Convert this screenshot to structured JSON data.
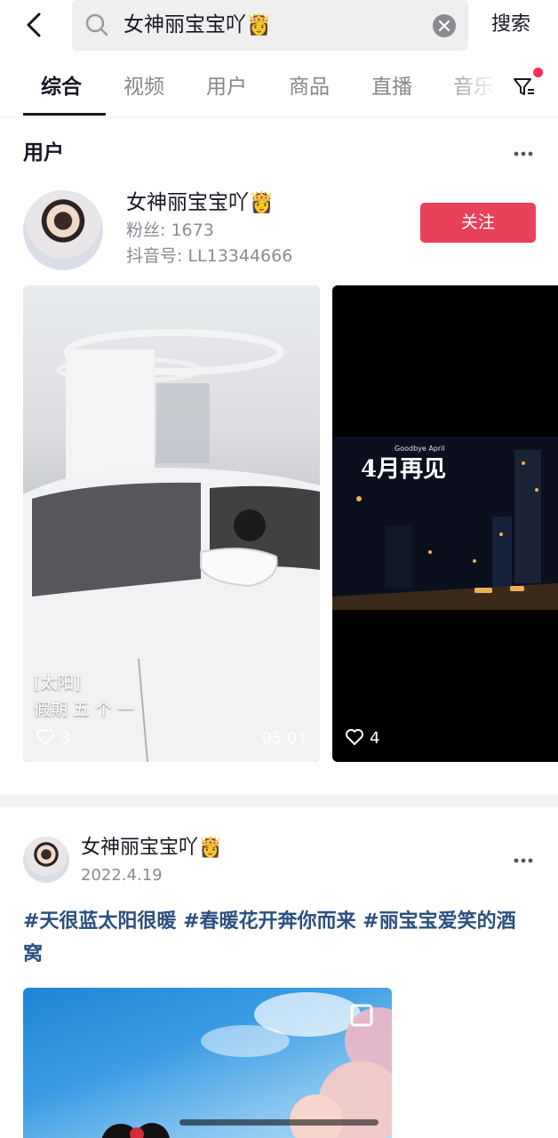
{
  "search": {
    "query": "女神丽宝宝吖👸",
    "submit_label": "搜索"
  },
  "tabs": [
    {
      "label": "综合",
      "active": true
    },
    {
      "label": "视频"
    },
    {
      "label": "用户"
    },
    {
      "label": "商品"
    },
    {
      "label": "直播"
    },
    {
      "label": "音乐"
    }
  ],
  "user_section": {
    "title": "用户",
    "user": {
      "name": "女神丽宝宝吖👸",
      "fans": "粉丝: 1673",
      "douyin_id": "抖音号: LL13344666",
      "follow_label": "关注"
    },
    "videos": [
      {
        "caption_line1": "[太阳]",
        "caption_line2": "假期 五 个  一",
        "likes": "3",
        "date": "05.01"
      },
      {
        "overlay_text": "4月再见",
        "overlay_sub": "Goodbye April",
        "likes": "4"
      }
    ]
  },
  "post": {
    "author": "女神丽宝宝吖👸",
    "date": "2022.4.19",
    "text": "#天很蓝太阳很暖 #春暖花开奔你而来 #丽宝宝爱笑的酒窝"
  },
  "colors": {
    "accent": "#e8415a",
    "hashtag": "#2c4f7f",
    "notification_dot": "#fe2c55"
  }
}
